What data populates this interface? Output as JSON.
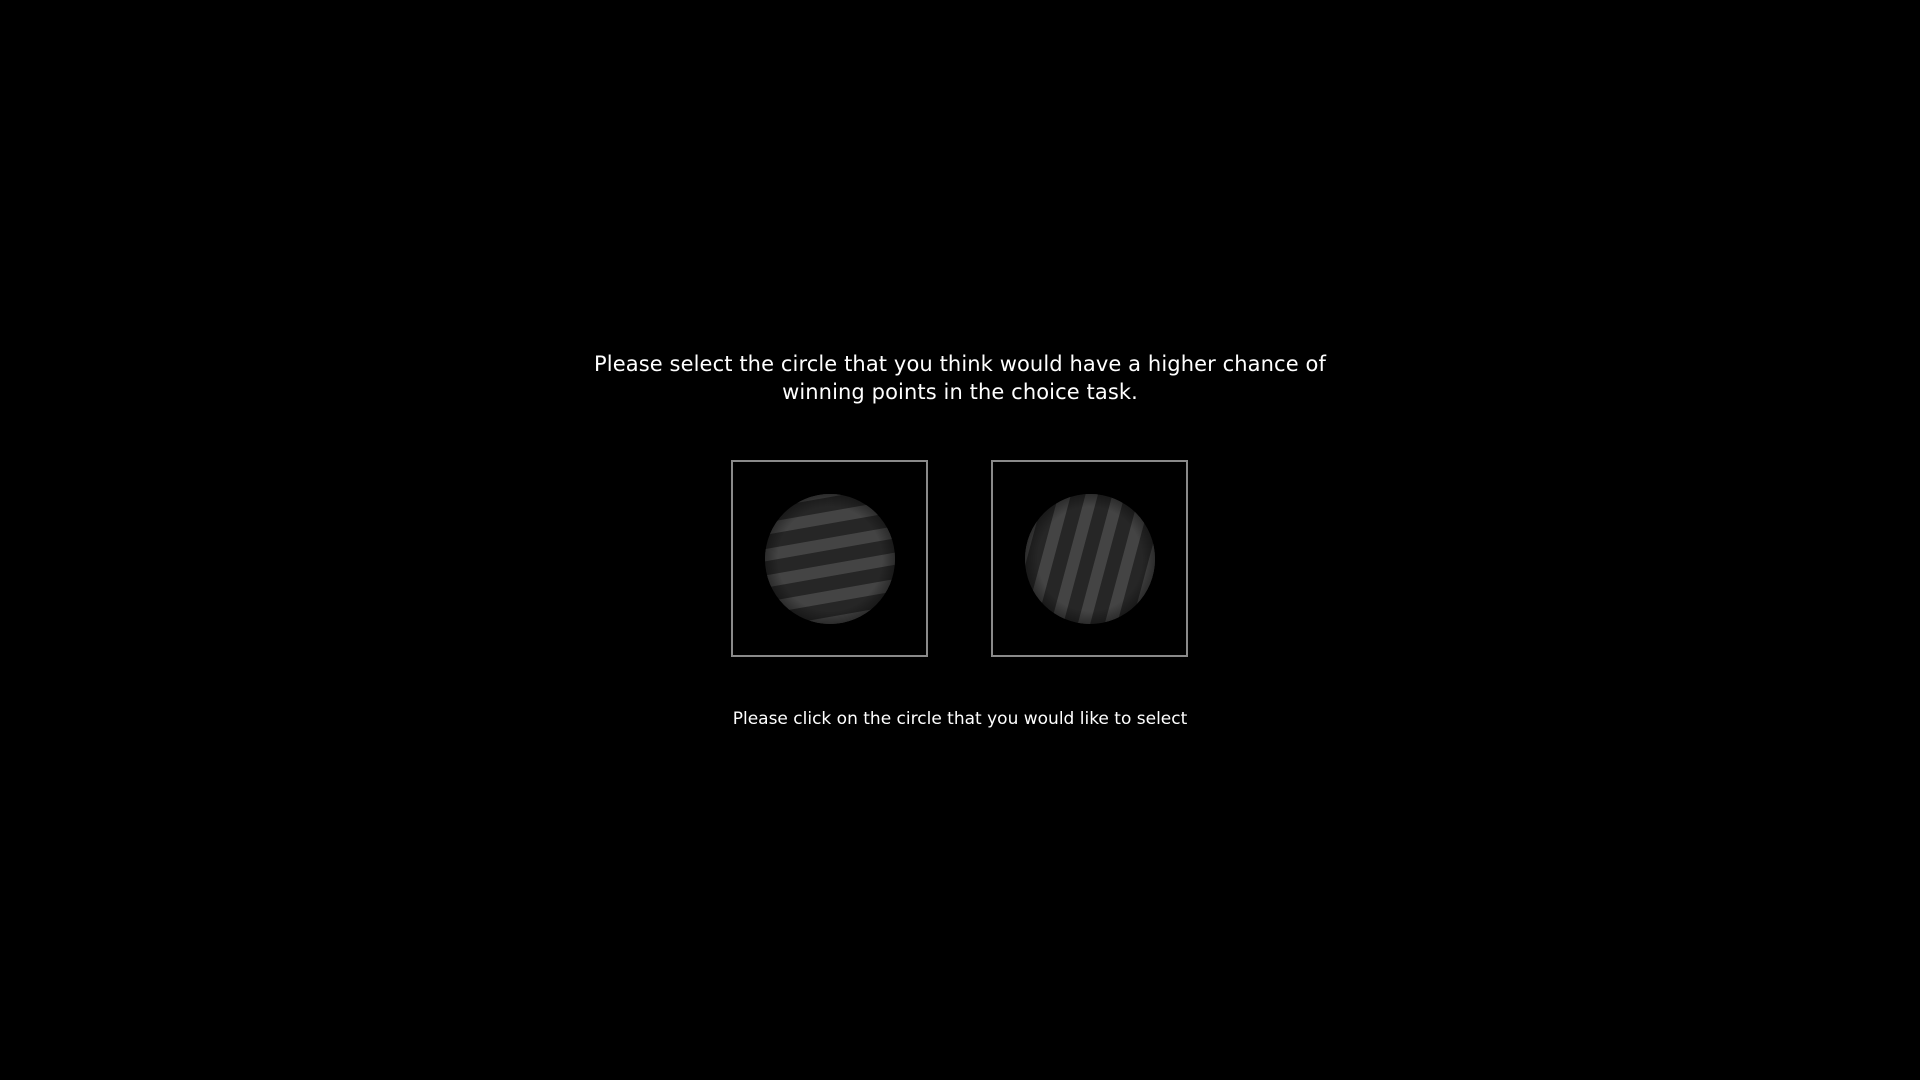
{
  "prompt": {
    "question": "Please select the circle that you think would have a higher chance of winning points in the choice task.",
    "instruction": "Please click on the circle that you would like to select"
  },
  "choices": [
    {
      "id": "left",
      "icon": "grating-circle-icon",
      "orientation_deg": -10
    },
    {
      "id": "right",
      "icon": "grating-circle-icon",
      "orientation_deg": 15
    }
  ],
  "colors": {
    "background": "#000000",
    "frame_border": "#8a8a8a",
    "grating_dark": "#262626",
    "grating_light": "#4a4a4a",
    "text": "#ffffff"
  }
}
